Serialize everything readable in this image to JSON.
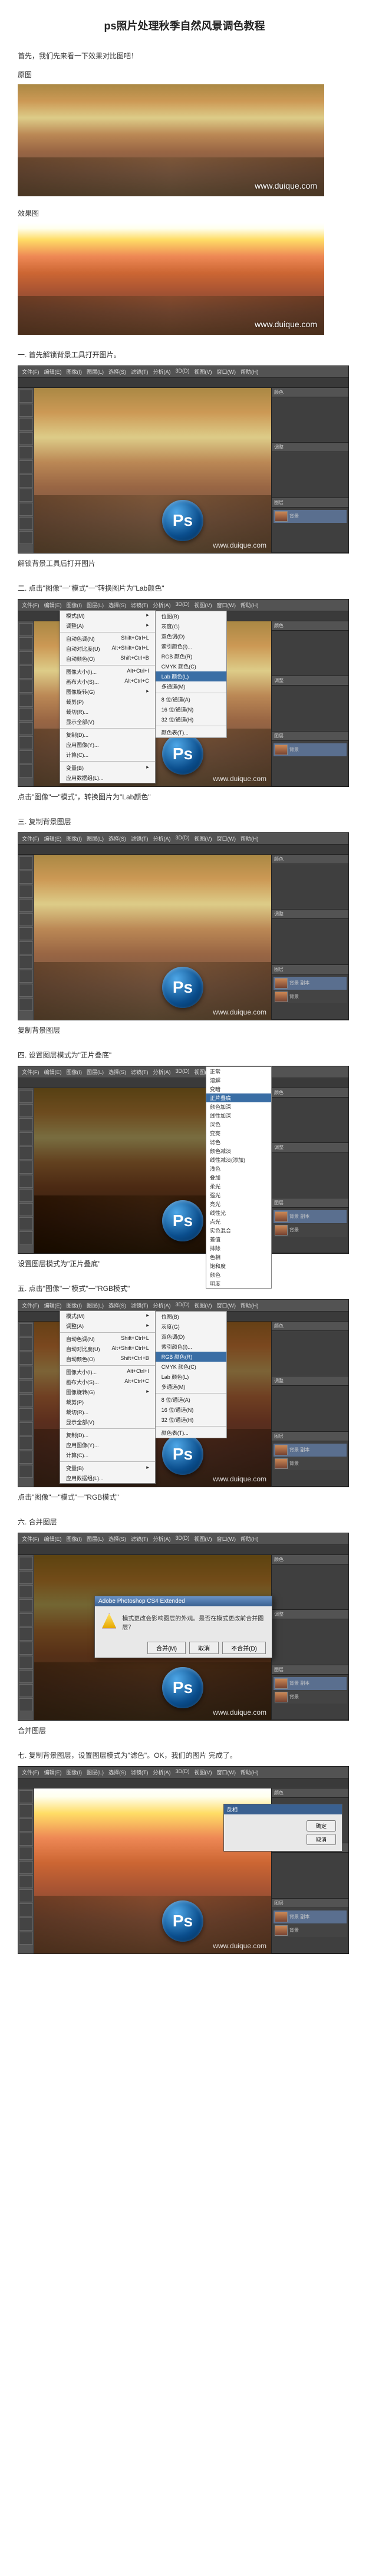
{
  "title": "ps照片处理秋季自然风景调色教程",
  "intro": "首先，我们先来看一下效果对比图吧！",
  "labels": {
    "original": "原图",
    "result": "效果图"
  },
  "watermark": "www.duique.com",
  "ps_watermark": "www.duique.com",
  "ps_logo_text": "Ps",
  "menu_items": [
    "文件(F)",
    "编辑(E)",
    "图像(I)",
    "图层(L)",
    "选择(S)",
    "滤镜(T)",
    "分析(A)",
    "3D(D)",
    "视图(V)",
    "窗口(W)",
    "帮助(H)"
  ],
  "tool_count": 11,
  "steps": {
    "s1": {
      "heading": "一. 首先解锁背景工具打开图片。",
      "caption": "解锁背景工具后打开图片"
    },
    "s2": {
      "heading": "二. 点击\"图像\"一\"模式\"一\"转换图片为\"Lab颜色\"",
      "caption": "点击\"图像\"一\"模式\"，转换图片为\"Lab颜色\"",
      "menu": {
        "items": [
          {
            "t": "模式(M)",
            "s": "▸"
          },
          {
            "t": "调整(A)",
            "s": "▸"
          },
          {
            "sep": true
          },
          {
            "t": "自动色调(N)",
            "s": "Shift+Ctrl+L"
          },
          {
            "t": "自动对比度(U)",
            "s": "Alt+Shift+Ctrl+L"
          },
          {
            "t": "自动颜色(O)",
            "s": "Shift+Ctrl+B"
          },
          {
            "sep": true
          },
          {
            "t": "图像大小(I)...",
            "s": "Alt+Ctrl+I"
          },
          {
            "t": "画布大小(S)...",
            "s": "Alt+Ctrl+C"
          },
          {
            "t": "图像旋转(G)",
            "s": "▸"
          },
          {
            "t": "裁剪(P)",
            "s": ""
          },
          {
            "t": "裁切(R)...",
            "s": ""
          },
          {
            "t": "显示全部(V)",
            "s": ""
          },
          {
            "sep": true
          },
          {
            "t": "复制(D)...",
            "s": ""
          },
          {
            "t": "应用图像(Y)...",
            "s": ""
          },
          {
            "t": "计算(C)...",
            "s": ""
          },
          {
            "sep": true
          },
          {
            "t": "变量(B)",
            "s": "▸"
          },
          {
            "t": "应用数据组(L)...",
            "s": ""
          }
        ],
        "sub": [
          "位图(B)",
          "灰度(G)",
          "双色调(D)",
          "索引颜色(I)...",
          "RGB 颜色(R)",
          "CMYK 颜色(C)",
          "Lab 颜色(L)",
          "多通道(M)",
          "",
          "8 位/通道(A)",
          "16 位/通道(N)",
          "32 位/通道(H)",
          "",
          "颜色表(T)..."
        ],
        "hi": "Lab 颜色(L)"
      }
    },
    "s3": {
      "heading": "三. 复制背景图层",
      "caption": "复制背景图层"
    },
    "s4": {
      "heading": "四. 设置图层模式为\"正片叠底\"",
      "caption": "设置图层模式为\"正片叠底\"",
      "blend_options": [
        "正常",
        "溶解",
        "",
        "变暗",
        "正片叠底",
        "颜色加深",
        "线性加深",
        "深色",
        "",
        "变亮",
        "滤色",
        "颜色减淡",
        "线性减淡(添加)",
        "浅色",
        "",
        "叠加",
        "柔光",
        "强光",
        "亮光",
        "线性光",
        "点光",
        "实色混合",
        "",
        "差值",
        "排除",
        "",
        "色相",
        "饱和度",
        "颜色",
        "明度"
      ],
      "blend_hi": "正片叠底"
    },
    "s5": {
      "heading": "五. 点击\"图像\"一\"模式\"一\"RGB模式\"",
      "caption": "点击\"图像\"一\"模式\"一\"RGB模式\"",
      "sub_hi": "RGB 颜色(R)"
    },
    "s6": {
      "heading": "六. 合并图层",
      "caption": "合并图层",
      "dialog": {
        "title": "Adobe Photoshop CS4 Extended",
        "text": "模式更改会影响图层的外观。是否在模式更改前合并图层？",
        "btn1": "合并(M)",
        "btn2": "取消",
        "btn3": "不合并(D)"
      }
    },
    "s7": {
      "heading": "七. 复制背景图层，设置图层模式为\"滤色\"。OK，我们的图片 完成了。",
      "dlg2": {
        "title": "反相",
        "ok": "确定",
        "cancel": "取消"
      }
    }
  },
  "layers": {
    "panel_title": "图层",
    "bg": "背景",
    "bg_copy": "背景 副本"
  }
}
